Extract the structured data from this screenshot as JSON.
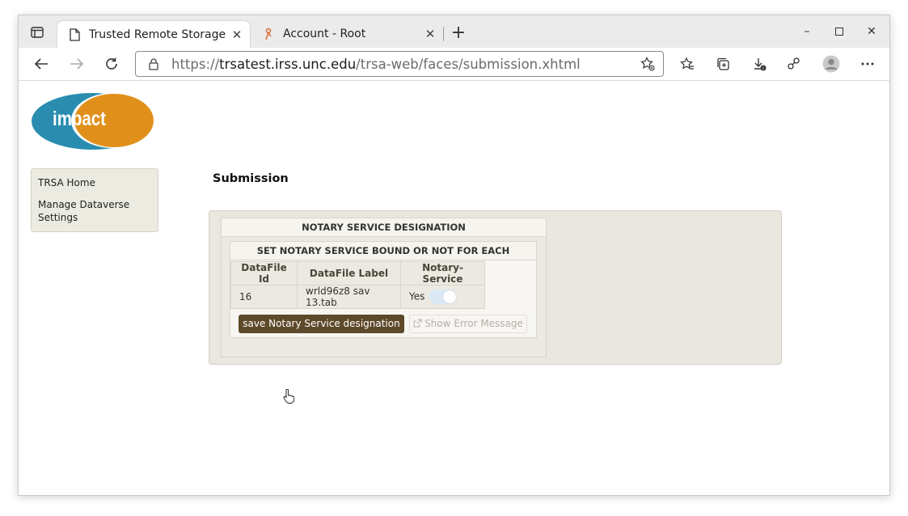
{
  "browser": {
    "tabs": [
      {
        "title": "Trusted Remote Storage Agent",
        "active": true
      },
      {
        "title": "Account - Root",
        "active": false
      }
    ],
    "url_scheme": "https://",
    "url_host": "trsatest.irss.unc.edu",
    "url_path": "/trsa-web/faces/submission.xhtml"
  },
  "logo": {
    "text": "impact"
  },
  "sidebar": {
    "items": [
      {
        "label": "TRSA Home"
      },
      {
        "label": "Manage Dataverse Settings"
      }
    ]
  },
  "page": {
    "title": "Submission"
  },
  "notary": {
    "header": "NOTARY SERVICE DESIGNATION",
    "subheader": "SET NOTARY SERVICE BOUND OR NOT FOR EACH INGESTED FILE",
    "columns": [
      "DataFile Id",
      "DataFile Label",
      "Notary-Service"
    ],
    "rows": [
      {
        "id": "16",
        "label": "wrld96z8 sav 13.tab",
        "notary": "Yes"
      }
    ],
    "save_label": "save Notary Service designation",
    "error_label": "Show Error Message"
  },
  "colors": {
    "accent_button": "#5e4a2a",
    "logo_blue": "#2a8db0",
    "logo_orange": "#e0901a"
  }
}
